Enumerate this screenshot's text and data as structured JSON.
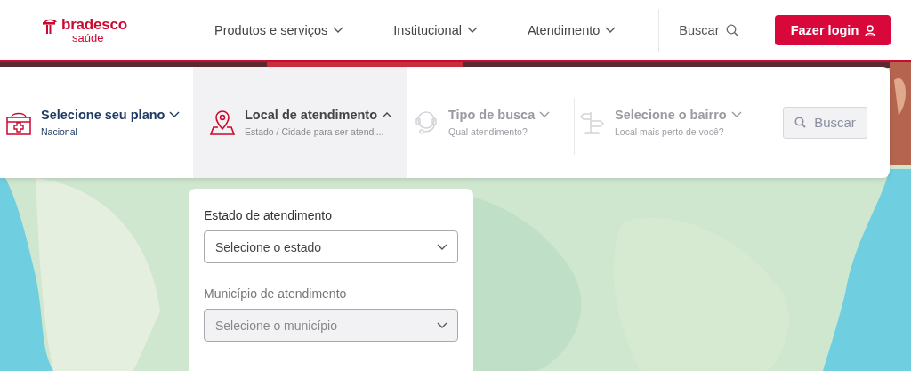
{
  "header": {
    "logo": {
      "brand": "bradesco",
      "product": "saúde"
    },
    "nav": [
      {
        "label": "Produtos e serviços"
      },
      {
        "label": "Institucional"
      },
      {
        "label": "Atendimento"
      }
    ],
    "search": {
      "label": "Buscar"
    },
    "login": {
      "label": "Fazer login"
    }
  },
  "search_bar": {
    "filters": [
      {
        "kind": "plan",
        "title": "Selecione seu plano",
        "subtitle": "Nacional",
        "expanded": false,
        "disabled": false
      },
      {
        "kind": "location",
        "title": "Local de atendimento",
        "subtitle": "Estado / Cidade para ser atendi...",
        "expanded": true,
        "disabled": false
      },
      {
        "kind": "type",
        "title": "Tipo de busca",
        "subtitle": "Qual atendimento?",
        "expanded": false,
        "disabled": true
      },
      {
        "kind": "district",
        "title": "Selecione o bairro",
        "subtitle": "Local mais perto de você?",
        "expanded": false,
        "disabled": true
      }
    ],
    "button": {
      "label": "Buscar",
      "disabled": true
    }
  },
  "location_panel": {
    "fields": [
      {
        "label": "Estado de atendimento",
        "placeholder": "Selecione o estado",
        "disabled": false
      },
      {
        "label": "Município de atendimento",
        "placeholder": "Selecione o município",
        "disabled": true
      }
    ]
  }
}
